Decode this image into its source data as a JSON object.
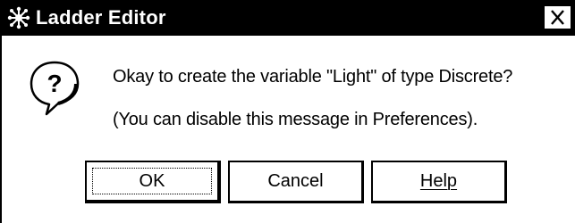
{
  "window": {
    "title": "Ladder Editor",
    "app_icon": "ladder-editor-icon",
    "close_icon": "close-icon"
  },
  "message": {
    "icon": "question-balloon-icon",
    "line1": "Okay to create the variable \"Light\" of type Discrete?",
    "line2": "(You can disable this message in Preferences)."
  },
  "buttons": {
    "ok": "OK",
    "cancel": "Cancel",
    "help": "Help"
  }
}
